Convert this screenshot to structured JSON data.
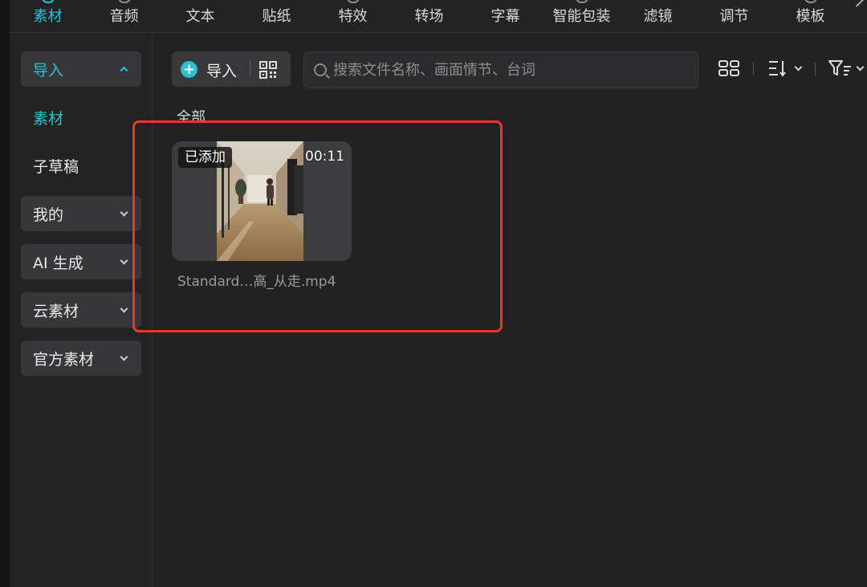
{
  "top_tabs": [
    {
      "label": "素材",
      "active": true
    },
    {
      "label": "音频"
    },
    {
      "label": "文本"
    },
    {
      "label": "贴纸"
    },
    {
      "label": "特效"
    },
    {
      "label": "转场"
    },
    {
      "label": "字幕"
    },
    {
      "label": "智能包装"
    },
    {
      "label": "滤镜"
    },
    {
      "label": "调节"
    },
    {
      "label": "模板"
    }
  ],
  "sidebar": {
    "items": [
      {
        "label": "导入",
        "expanded": true
      },
      {
        "label": "素材",
        "selected": true
      },
      {
        "label": "子草稿"
      },
      {
        "label": "我的"
      },
      {
        "label": "AI 生成"
      },
      {
        "label": "云素材"
      },
      {
        "label": "官方素材"
      }
    ]
  },
  "toolbar": {
    "import_label": "导入",
    "search_placeholder": "搜索文件名称、画面情节、台词"
  },
  "content": {
    "section_title": "全部",
    "media": [
      {
        "badge": "已添加",
        "duration": "00:11",
        "filename": "Standard…高_从走.mp4"
      }
    ]
  },
  "colors": {
    "accent": "#29c0d1",
    "highlight_border": "#e8382a",
    "background": "#222223"
  }
}
